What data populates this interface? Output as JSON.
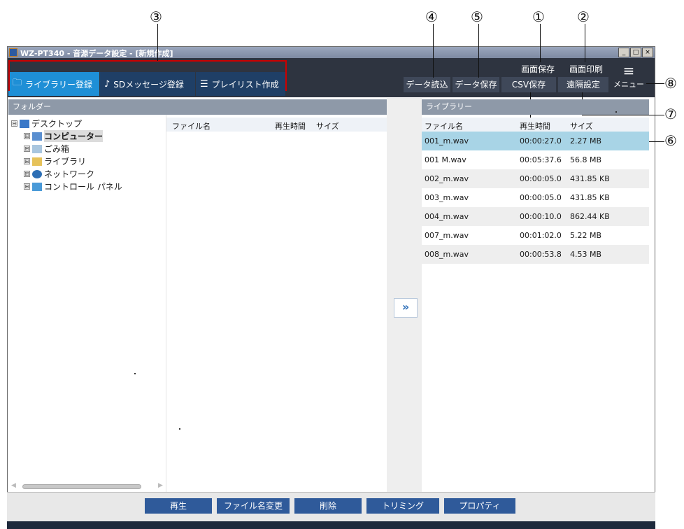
{
  "callouts": [
    "③",
    "④",
    "⑤",
    "①",
    "②",
    "⑧",
    "⑦",
    "⑥"
  ],
  "window": {
    "title": "WZ-PT340 - 音源データ設定 - [新規作成]",
    "controls": [
      "_",
      "□",
      "×"
    ]
  },
  "tabs": [
    {
      "label": "ライブラリー登録",
      "icon": "library-icon",
      "active": true
    },
    {
      "label": "SDメッセージ登録",
      "icon": "sd-message-icon",
      "active": false
    },
    {
      "label": "プレイリスト作成",
      "icon": "playlist-icon",
      "active": false
    }
  ],
  "toolbar": {
    "screen_save": "画面保存",
    "screen_print": "画面印刷",
    "data_load": "データ読込",
    "data_save": "データ保存",
    "csv_save": "CSV保存",
    "remote_settings": "遠隔設定",
    "menu": "メニュー"
  },
  "folder_panel": {
    "header": "フォルダー",
    "tree": [
      {
        "label": "デスクトップ",
        "icon": "desktop-icon",
        "expander": "⊟"
      },
      {
        "label": "コンピューター",
        "icon": "computer-icon",
        "expander": "⊞",
        "selected": true
      },
      {
        "label": "ごみ箱",
        "icon": "recycle-bin-icon",
        "expander": "⊞"
      },
      {
        "label": "ライブラリ",
        "icon": "library-folder-icon",
        "expander": "⊞"
      },
      {
        "label": "ネットワーク",
        "icon": "network-icon",
        "expander": "⊞"
      },
      {
        "label": "コントロール パネル",
        "icon": "control-panel-icon",
        "expander": "⊞"
      }
    ]
  },
  "file_panel": {
    "columns": [
      "ファイル名",
      "再生時間",
      "サイズ"
    ]
  },
  "transfer_button": "»",
  "library_panel": {
    "header": "ライブラリー",
    "columns": [
      "ファイル名",
      "再生時間",
      "サイズ"
    ],
    "rows": [
      [
        "001_m.wav",
        "00:00:27.0",
        "2.27 MB"
      ],
      [
        "001 M.wav",
        "00:05:37.6",
        "56.8 MB"
      ],
      [
        "002_m.wav",
        "00:00:05.0",
        "431.85 KB"
      ],
      [
        "003_m.wav",
        "00:00:05.0",
        "431.85 KB"
      ],
      [
        "004_m.wav",
        "00:00:10.0",
        "862.44 KB"
      ],
      [
        "007_m.wav",
        "00:01:02.0",
        "5.22 MB"
      ],
      [
        "008_m.wav",
        "00:00:53.8",
        "4.53 MB"
      ]
    ]
  },
  "bottom_buttons": {
    "play": "再生",
    "rename": "ファイル名変更",
    "delete": "削除",
    "trimming": "トリミング",
    "properties": "プロパティ"
  },
  "colors": {
    "toolbar_bg": "#2e3440",
    "active_tab": "#1e8fd6",
    "inactive_tab": "#1f3f66",
    "panel_header": "#8e99a8",
    "selected_row": "#a8d4e6",
    "bottom_button": "#2f5a9a",
    "callout_box": "#cc0000"
  }
}
